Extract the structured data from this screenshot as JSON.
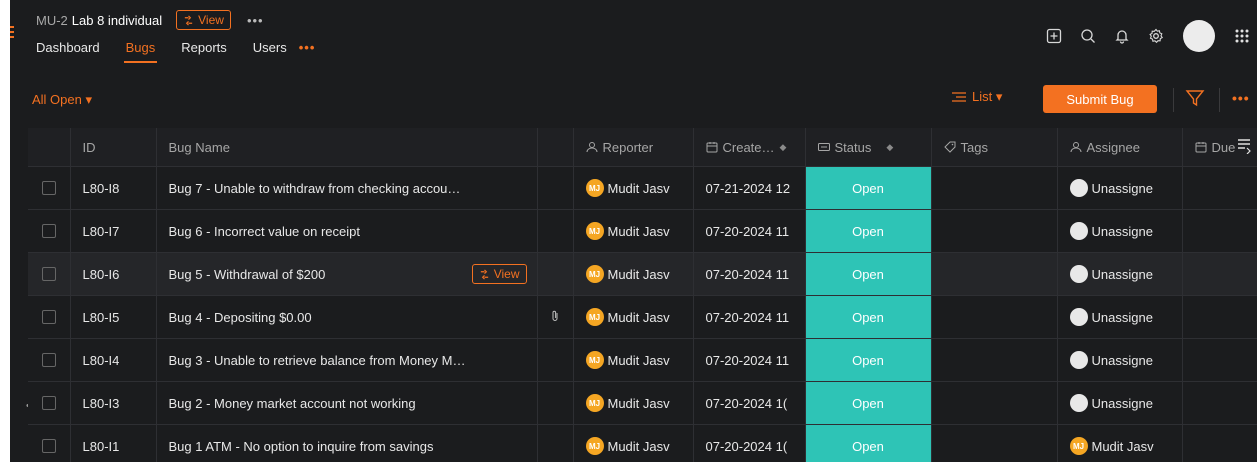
{
  "header": {
    "project_prefix": "MU-2",
    "project_name": "Lab 8 individual",
    "view_label": "View",
    "more": "•••",
    "tabs": [
      {
        "label": "Dashboard",
        "active": false
      },
      {
        "label": "Bugs",
        "active": true
      },
      {
        "label": "Reports",
        "active": false
      },
      {
        "label": "Users",
        "active": false
      }
    ],
    "tabs_more": "•••",
    "icons": [
      "add-icon",
      "search-icon",
      "bell-icon",
      "gear-icon",
      "avatar",
      "apps-grid-icon"
    ]
  },
  "toolbar": {
    "filter_label": "All Open ▾",
    "list_label": "List ▾",
    "submit_label": "Submit Bug",
    "more": "•••"
  },
  "table": {
    "columns": {
      "id": "ID",
      "name": "Bug Name",
      "reporter": "Reporter",
      "created": "Create…",
      "status": "Status",
      "tags": "Tags",
      "assignee": "Assignee",
      "due": "Due"
    },
    "rows": [
      {
        "id": "L80-I8",
        "name": "Bug 7 - Unable to withdraw from checking accou…",
        "reporter": "Mudit Jasv",
        "reporter_initials": "MJ",
        "created": "07-21-2024 12",
        "status": "Open",
        "assignee": "Unassigne",
        "assignee_initials": "",
        "view": "",
        "attach": ""
      },
      {
        "id": "L80-I7",
        "name": "Bug 6 - Incorrect value on receipt",
        "reporter": "Mudit Jasv",
        "reporter_initials": "MJ",
        "created": "07-20-2024 11",
        "status": "Open",
        "assignee": "Unassigne",
        "assignee_initials": "",
        "view": "",
        "attach": ""
      },
      {
        "id": "L80-I6",
        "name": "Bug 5 - Withdrawal of $200",
        "reporter": "Mudit Jasv",
        "reporter_initials": "MJ",
        "created": "07-20-2024 11",
        "status": "Open",
        "assignee": "Unassigne",
        "assignee_initials": "",
        "view": "View",
        "attach": ""
      },
      {
        "id": "L80-I5",
        "name": "Bug 4 - Depositing $0.00",
        "reporter": "Mudit Jasv",
        "reporter_initials": "MJ",
        "created": "07-20-2024 11",
        "status": "Open",
        "assignee": "Unassigne",
        "assignee_initials": "",
        "view": "",
        "attach": "attach"
      },
      {
        "id": "L80-I4",
        "name": "Bug 3 - Unable to retrieve balance from Money M…",
        "reporter": "Mudit Jasv",
        "reporter_initials": "MJ",
        "created": "07-20-2024 11",
        "status": "Open",
        "assignee": "Unassigne",
        "assignee_initials": "",
        "view": "",
        "attach": ""
      },
      {
        "id": "L80-I3",
        "name": "Bug 2 - Money market account not working",
        "reporter": "Mudit Jasv",
        "reporter_initials": "MJ",
        "created": "07-20-2024 1(",
        "status": "Open",
        "assignee": "Unassigne",
        "assignee_initials": "",
        "view": "",
        "attach": ""
      },
      {
        "id": "L80-I1",
        "name": "Bug 1 ATM - No option to inquire from savings",
        "reporter": "Mudit Jasv",
        "reporter_initials": "MJ",
        "created": "07-20-2024 1(",
        "status": "Open",
        "assignee": "Mudit Jasv",
        "assignee_initials": "MJ",
        "view": "",
        "attach": ""
      }
    ]
  },
  "colors": {
    "accent": "#f37121",
    "status_open": "#2ec4b6",
    "background": "#1b1c1e",
    "avatar_mj": "#f5a623"
  }
}
